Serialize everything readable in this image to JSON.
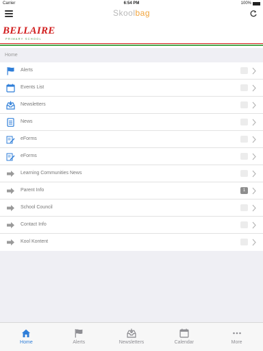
{
  "status": {
    "carrier": "Carrier",
    "time": "6:54 PM",
    "battery": "100%"
  },
  "navbar": {
    "brand_a": "Skool",
    "brand_b": "bag"
  },
  "banner": {
    "logo_title": "BELLAIRE",
    "logo_subtitle": "PRIMARY SCHOOL"
  },
  "breadcrumb": "Home",
  "menu": [
    {
      "label": "Alerts",
      "icon": "flag-icon",
      "badge": ""
    },
    {
      "label": "Events List",
      "icon": "calendar-icon",
      "badge": ""
    },
    {
      "label": "Newsletters",
      "icon": "inbox-icon",
      "badge": ""
    },
    {
      "label": "News",
      "icon": "document-icon",
      "badge": ""
    },
    {
      "label": "eForms",
      "icon": "form-pencil-icon",
      "badge": ""
    },
    {
      "label": "eForms",
      "icon": "form-pencil-icon",
      "badge": ""
    },
    {
      "label": "Learning Communities News",
      "icon": "arrow-right-icon",
      "badge": ""
    },
    {
      "label": "Parent Info",
      "icon": "arrow-right-icon",
      "badge": "1"
    },
    {
      "label": "School Council",
      "icon": "arrow-right-icon",
      "badge": ""
    },
    {
      "label": "Contact Info",
      "icon": "arrow-right-icon",
      "badge": ""
    },
    {
      "label": "Kool Kontent",
      "icon": "arrow-right-icon",
      "badge": ""
    }
  ],
  "tabs": [
    {
      "label": "Home",
      "icon": "home-icon",
      "active": true
    },
    {
      "label": "Alerts",
      "icon": "flag-icon",
      "active": false
    },
    {
      "label": "Newsletters",
      "icon": "inbox-icon",
      "active": false
    },
    {
      "label": "Calendar",
      "icon": "calendar-icon",
      "active": false
    },
    {
      "label": "More",
      "icon": "more-dots-icon",
      "active": false
    }
  ],
  "colors": {
    "accent": "#2f7ed8",
    "brand_red": "#d11e1e",
    "brand_green": "#4aa54a",
    "brand_orange": "#f0a33a"
  }
}
